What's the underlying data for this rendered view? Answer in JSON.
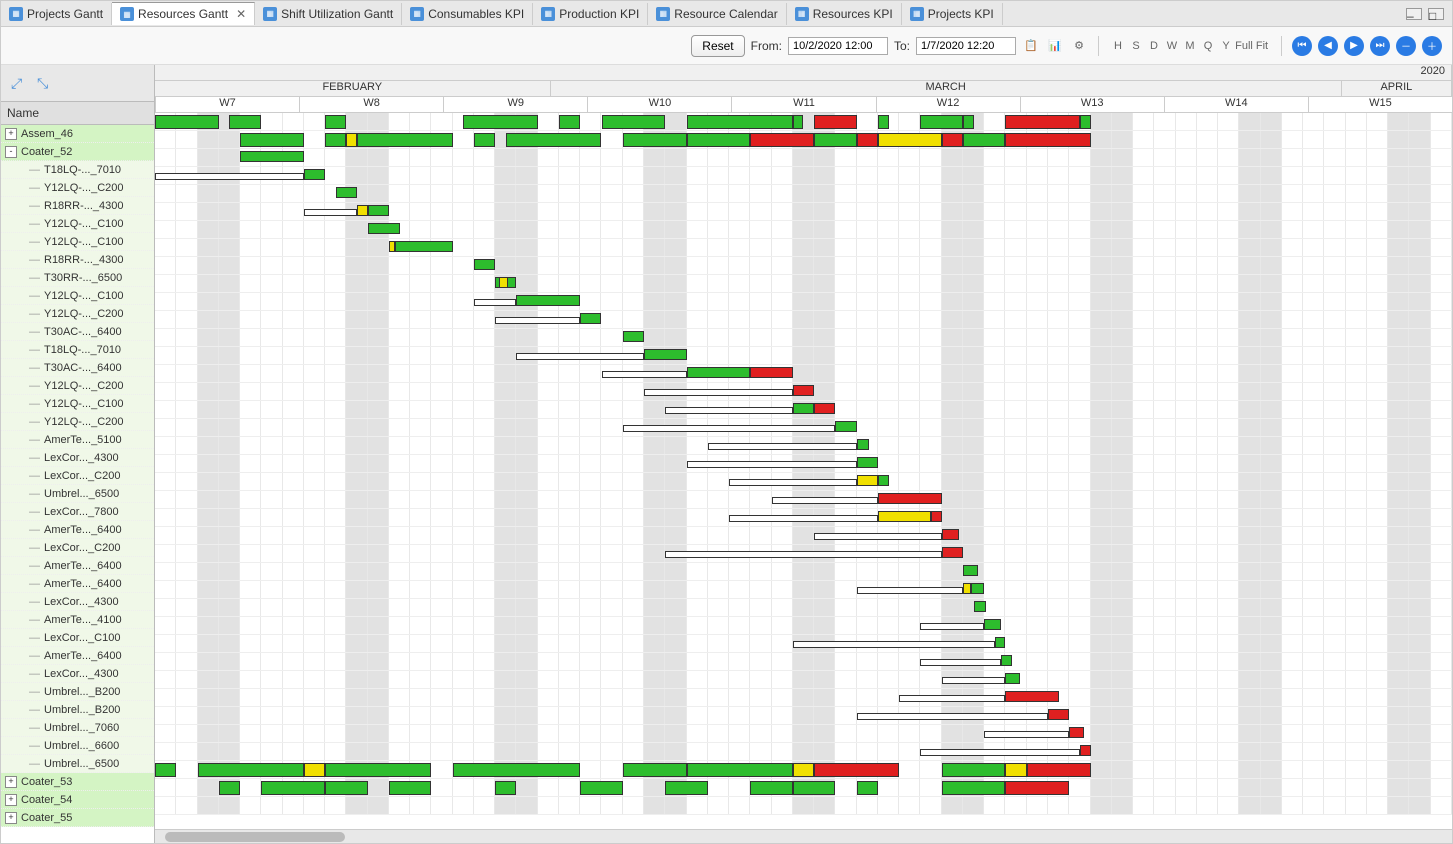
{
  "tabs": [
    {
      "label": "Projects Gantt",
      "active": false
    },
    {
      "label": "Resources Gantt",
      "active": true,
      "closable": true
    },
    {
      "label": "Shift Utilization Gantt",
      "active": false
    },
    {
      "label": "Consumables KPI",
      "active": false
    },
    {
      "label": "Production KPI",
      "active": false
    },
    {
      "label": "Resource Calendar",
      "active": false
    },
    {
      "label": "Resources KPI",
      "active": false
    },
    {
      "label": "Projects KPI",
      "active": false
    }
  ],
  "toolbar": {
    "reset": "Reset",
    "from_label": "From:",
    "from_value": "10/2/2020 12:00",
    "to_label": "To:",
    "to_value": "1/7/2020 12:20",
    "scale_buttons": [
      "H",
      "S",
      "D",
      "W",
      "M",
      "Q",
      "Y",
      "Full",
      "Fit"
    ]
  },
  "tree_header": "Name",
  "tree": [
    {
      "label": "Assem_46",
      "type": "summary",
      "exp": "+"
    },
    {
      "label": "Coater_52",
      "type": "summary",
      "exp": "-"
    },
    {
      "label": "T18LQ-..._7010",
      "type": "child"
    },
    {
      "label": "Y12LQ-..._C200",
      "type": "child"
    },
    {
      "label": "R18RR-..._4300",
      "type": "child"
    },
    {
      "label": "Y12LQ-..._C100",
      "type": "child"
    },
    {
      "label": "Y12LQ-..._C100",
      "type": "child"
    },
    {
      "label": "R18RR-..._4300",
      "type": "child"
    },
    {
      "label": "T30RR-..._6500",
      "type": "child"
    },
    {
      "label": "Y12LQ-..._C100",
      "type": "child"
    },
    {
      "label": "Y12LQ-..._C200",
      "type": "child"
    },
    {
      "label": "T30AC-..._6400",
      "type": "child"
    },
    {
      "label": "T18LQ-..._7010",
      "type": "child"
    },
    {
      "label": "T30AC-..._6400",
      "type": "child"
    },
    {
      "label": "Y12LQ-..._C200",
      "type": "child"
    },
    {
      "label": "Y12LQ-..._C100",
      "type": "child"
    },
    {
      "label": "Y12LQ-..._C200",
      "type": "child"
    },
    {
      "label": "AmerTe..._5100",
      "type": "child"
    },
    {
      "label": "LexCor..._4300",
      "type": "child"
    },
    {
      "label": "LexCor..._C200",
      "type": "child"
    },
    {
      "label": "Umbrel..._6500",
      "type": "child"
    },
    {
      "label": "LexCor..._7800",
      "type": "child"
    },
    {
      "label": "AmerTe..._6400",
      "type": "child"
    },
    {
      "label": "LexCor..._C200",
      "type": "child"
    },
    {
      "label": "AmerTe..._6400",
      "type": "child"
    },
    {
      "label": "AmerTe..._6400",
      "type": "child"
    },
    {
      "label": "LexCor..._4300",
      "type": "child"
    },
    {
      "label": "AmerTe..._4100",
      "type": "child"
    },
    {
      "label": "LexCor..._C100",
      "type": "child"
    },
    {
      "label": "AmerTe..._6400",
      "type": "child"
    },
    {
      "label": "LexCor..._4300",
      "type": "child"
    },
    {
      "label": "Umbrel..._B200",
      "type": "child"
    },
    {
      "label": "Umbrel..._B200",
      "type": "child"
    },
    {
      "label": "Umbrel..._7060",
      "type": "child"
    },
    {
      "label": "Umbrel..._6600",
      "type": "child"
    },
    {
      "label": "Umbrel..._6500",
      "type": "child"
    },
    {
      "label": "Coater_53",
      "type": "summary",
      "exp": "+"
    },
    {
      "label": "Coater_54",
      "type": "summary",
      "exp": "+"
    },
    {
      "label": "Coater_55",
      "type": "summary",
      "exp": "+"
    }
  ],
  "timeline": {
    "year": "2020",
    "months": [
      {
        "label": "FEBRUARY",
        "width_pct": 30.5
      },
      {
        "label": "MARCH",
        "width_pct": 61
      },
      {
        "label": "APRIL",
        "width_pct": 8.5
      }
    ],
    "weeks": [
      "W7",
      "W8",
      "W9",
      "W10",
      "W11",
      "W12",
      "W13",
      "W14",
      "W15"
    ],
    "total_days": 61,
    "weekend_cols": [
      2,
      3,
      9,
      10,
      16,
      17,
      23,
      24,
      30,
      31,
      37,
      38,
      44,
      45,
      51,
      52,
      58,
      59
    ]
  },
  "chart_data": {
    "type": "gantt",
    "x_unit": "day_index_from_start",
    "rows": [
      {
        "name": "Assem_46",
        "bars": [
          {
            "s": 0,
            "e": 3,
            "c": "g"
          },
          {
            "s": 3.5,
            "e": 5,
            "c": "g"
          },
          {
            "s": 8,
            "e": 9,
            "c": "g"
          },
          {
            "s": 14.5,
            "e": 18,
            "c": "g"
          },
          {
            "s": 19,
            "e": 20,
            "c": "g"
          },
          {
            "s": 21,
            "e": 24,
            "c": "g"
          },
          {
            "s": 25,
            "e": 30,
            "c": "g"
          },
          {
            "s": 30,
            "e": 30.5,
            "c": "g"
          },
          {
            "s": 31,
            "e": 33,
            "c": "r"
          },
          {
            "s": 34,
            "e": 34.5,
            "c": "g"
          },
          {
            "s": 36,
            "e": 38,
            "c": "g"
          },
          {
            "s": 38,
            "e": 38.5,
            "c": "g"
          },
          {
            "s": 40,
            "e": 43.5,
            "c": "r"
          },
          {
            "s": 43.5,
            "e": 44,
            "c": "g"
          }
        ]
      },
      {
        "name": "Coater_52",
        "bars": [
          {
            "s": 4,
            "e": 7,
            "c": "g"
          },
          {
            "s": 8,
            "e": 9,
            "c": "g"
          },
          {
            "s": 9,
            "e": 9.5,
            "c": "y"
          },
          {
            "s": 9.5,
            "e": 14,
            "c": "g"
          },
          {
            "s": 15,
            "e": 16,
            "c": "g"
          },
          {
            "s": 16.5,
            "e": 21,
            "c": "g"
          },
          {
            "s": 22,
            "e": 25,
            "c": "g"
          },
          {
            "s": 25,
            "e": 28,
            "c": "g"
          },
          {
            "s": 28,
            "e": 31,
            "c": "r"
          },
          {
            "s": 31,
            "e": 33,
            "c": "g"
          },
          {
            "s": 33,
            "e": 34,
            "c": "r"
          },
          {
            "s": 34,
            "e": 37,
            "c": "y"
          },
          {
            "s": 37,
            "e": 38,
            "c": "r"
          },
          {
            "s": 38,
            "e": 40,
            "c": "g"
          },
          {
            "s": 40,
            "e": 44,
            "c": "r"
          }
        ]
      },
      {
        "name": "T18LQ-..._7010",
        "bars": [
          {
            "s": 4,
            "e": 7,
            "c": "g"
          }
        ]
      },
      {
        "name": "Y12LQ-..._C200",
        "bars": [
          {
            "s": 0,
            "e": 7,
            "c": "w"
          },
          {
            "s": 7,
            "e": 8,
            "c": "g"
          }
        ]
      },
      {
        "name": "R18RR-..._4300",
        "bars": [
          {
            "s": 8.5,
            "e": 9.5,
            "c": "g"
          }
        ]
      },
      {
        "name": "Y12LQ-..._C100",
        "bars": [
          {
            "s": 7,
            "e": 9.5,
            "c": "w"
          },
          {
            "s": 9.5,
            "e": 10,
            "c": "y"
          },
          {
            "s": 10,
            "e": 11,
            "c": "g"
          }
        ]
      },
      {
        "name": "Y12LQ-..._C100",
        "bars": [
          {
            "s": 10,
            "e": 11.5,
            "c": "g"
          }
        ]
      },
      {
        "name": "R18RR-..._4300",
        "bars": [
          {
            "s": 11,
            "e": 11.3,
            "c": "y"
          },
          {
            "s": 11.3,
            "e": 14,
            "c": "g"
          }
        ]
      },
      {
        "name": "T30RR-..._6500",
        "bars": [
          {
            "s": 15,
            "e": 16,
            "c": "g"
          }
        ]
      },
      {
        "name": "Y12LQ-..._C100",
        "bars": [
          {
            "s": 16,
            "e": 17,
            "c": "g"
          },
          {
            "s": 16.2,
            "e": 16.6,
            "c": "y"
          }
        ]
      },
      {
        "name": "Y12LQ-..._C200",
        "bars": [
          {
            "s": 15,
            "e": 17,
            "c": "w"
          },
          {
            "s": 17,
            "e": 20,
            "c": "g"
          }
        ]
      },
      {
        "name": "T30AC-..._6400",
        "bars": [
          {
            "s": 16,
            "e": 20,
            "c": "w"
          },
          {
            "s": 20,
            "e": 21,
            "c": "g"
          }
        ]
      },
      {
        "name": "T18LQ-..._7010",
        "bars": [
          {
            "s": 22,
            "e": 23,
            "c": "g"
          }
        ]
      },
      {
        "name": "T30AC-..._6400",
        "bars": [
          {
            "s": 17,
            "e": 23,
            "c": "w"
          },
          {
            "s": 23,
            "e": 25,
            "c": "g"
          }
        ]
      },
      {
        "name": "Y12LQ-..._C200",
        "bars": [
          {
            "s": 21,
            "e": 25,
            "c": "w"
          },
          {
            "s": 25,
            "e": 28,
            "c": "g"
          },
          {
            "s": 28,
            "e": 30,
            "c": "r"
          }
        ]
      },
      {
        "name": "Y12LQ-..._C100",
        "bars": [
          {
            "s": 23,
            "e": 30,
            "c": "w"
          },
          {
            "s": 30,
            "e": 31,
            "c": "r"
          }
        ]
      },
      {
        "name": "Y12LQ-..._C200",
        "bars": [
          {
            "s": 24,
            "e": 30,
            "c": "w"
          },
          {
            "s": 30,
            "e": 31,
            "c": "g"
          },
          {
            "s": 31,
            "e": 32,
            "c": "r"
          }
        ]
      },
      {
        "name": "AmerTe..._5100",
        "bars": [
          {
            "s": 22,
            "e": 32,
            "c": "w"
          },
          {
            "s": 32,
            "e": 33,
            "c": "g"
          }
        ]
      },
      {
        "name": "LexCor..._4300",
        "bars": [
          {
            "s": 26,
            "e": 33,
            "c": "w"
          },
          {
            "s": 33,
            "e": 33.6,
            "c": "g"
          }
        ]
      },
      {
        "name": "LexCor..._C200",
        "bars": [
          {
            "s": 25,
            "e": 33,
            "c": "w"
          },
          {
            "s": 33,
            "e": 34,
            "c": "g"
          }
        ]
      },
      {
        "name": "Umbrel..._6500",
        "bars": [
          {
            "s": 27,
            "e": 33,
            "c": "w"
          },
          {
            "s": 33,
            "e": 34,
            "c": "y"
          },
          {
            "s": 34,
            "e": 34.5,
            "c": "g"
          }
        ]
      },
      {
        "name": "LexCor..._7800",
        "bars": [
          {
            "s": 29,
            "e": 34,
            "c": "w"
          },
          {
            "s": 34,
            "e": 37,
            "c": "r"
          }
        ]
      },
      {
        "name": "AmerTe..._6400",
        "bars": [
          {
            "s": 27,
            "e": 34,
            "c": "w"
          },
          {
            "s": 34,
            "e": 36.5,
            "c": "y"
          },
          {
            "s": 36.5,
            "e": 37,
            "c": "r"
          }
        ]
      },
      {
        "name": "LexCor..._C200",
        "bars": [
          {
            "s": 31,
            "e": 37,
            "c": "w"
          },
          {
            "s": 37,
            "e": 37.8,
            "c": "r"
          }
        ]
      },
      {
        "name": "AmerTe..._6400",
        "bars": [
          {
            "s": 24,
            "e": 37,
            "c": "w"
          },
          {
            "s": 37,
            "e": 38,
            "c": "r"
          }
        ]
      },
      {
        "name": "AmerTe..._6400",
        "bars": [
          {
            "s": 38,
            "e": 38.7,
            "c": "g"
          }
        ]
      },
      {
        "name": "LexCor..._4300",
        "bars": [
          {
            "s": 33,
            "e": 38,
            "c": "w"
          },
          {
            "s": 38,
            "e": 38.4,
            "c": "y"
          },
          {
            "s": 38.4,
            "e": 39,
            "c": "g"
          }
        ]
      },
      {
        "name": "AmerTe..._4100",
        "bars": [
          {
            "s": 38.5,
            "e": 39.1,
            "c": "g"
          }
        ]
      },
      {
        "name": "LexCor..._C100",
        "bars": [
          {
            "s": 36,
            "e": 39,
            "c": "w"
          },
          {
            "s": 39,
            "e": 39.8,
            "c": "g"
          }
        ]
      },
      {
        "name": "AmerTe..._6400",
        "bars": [
          {
            "s": 30,
            "e": 39.5,
            "c": "w"
          },
          {
            "s": 39.5,
            "e": 40,
            "c": "g"
          }
        ]
      },
      {
        "name": "LexCor..._4300",
        "bars": [
          {
            "s": 36,
            "e": 39.8,
            "c": "w"
          },
          {
            "s": 39.8,
            "e": 40.3,
            "c": "g"
          }
        ]
      },
      {
        "name": "Umbrel..._B200",
        "bars": [
          {
            "s": 37,
            "e": 40,
            "c": "w"
          },
          {
            "s": 40,
            "e": 40.7,
            "c": "g"
          }
        ]
      },
      {
        "name": "Umbrel..._B200",
        "bars": [
          {
            "s": 35,
            "e": 40,
            "c": "w"
          },
          {
            "s": 40,
            "e": 42.5,
            "c": "r"
          }
        ]
      },
      {
        "name": "Umbrel..._7060",
        "bars": [
          {
            "s": 33,
            "e": 42,
            "c": "w"
          },
          {
            "s": 42,
            "e": 43,
            "c": "r"
          }
        ]
      },
      {
        "name": "Umbrel..._6600",
        "bars": [
          {
            "s": 39,
            "e": 43,
            "c": "w"
          },
          {
            "s": 43,
            "e": 43.7,
            "c": "r"
          }
        ]
      },
      {
        "name": "Umbrel..._6500",
        "bars": [
          {
            "s": 36,
            "e": 43.5,
            "c": "w"
          },
          {
            "s": 43.5,
            "e": 44,
            "c": "r"
          }
        ]
      },
      {
        "name": "Coater_53",
        "bars": [
          {
            "s": 0,
            "e": 1,
            "c": "g"
          },
          {
            "s": 2,
            "e": 7,
            "c": "g"
          },
          {
            "s": 7,
            "e": 8,
            "c": "y"
          },
          {
            "s": 8,
            "e": 13,
            "c": "g"
          },
          {
            "s": 14,
            "e": 20,
            "c": "g"
          },
          {
            "s": 22,
            "e": 25,
            "c": "g"
          },
          {
            "s": 25,
            "e": 30,
            "c": "g"
          },
          {
            "s": 30,
            "e": 31,
            "c": "y"
          },
          {
            "s": 31,
            "e": 35,
            "c": "r"
          },
          {
            "s": 37,
            "e": 40,
            "c": "g"
          },
          {
            "s": 40,
            "e": 41,
            "c": "y"
          },
          {
            "s": 41,
            "e": 44,
            "c": "r"
          }
        ]
      },
      {
        "name": "Coater_54",
        "bars": [
          {
            "s": 3,
            "e": 4,
            "c": "g"
          },
          {
            "s": 5,
            "e": 8,
            "c": "g"
          },
          {
            "s": 8,
            "e": 10,
            "c": "g"
          },
          {
            "s": 11,
            "e": 13,
            "c": "g"
          },
          {
            "s": 16,
            "e": 17,
            "c": "g"
          },
          {
            "s": 20,
            "e": 22,
            "c": "g"
          },
          {
            "s": 24,
            "e": 26,
            "c": "g"
          },
          {
            "s": 28,
            "e": 30,
            "c": "g"
          },
          {
            "s": 30,
            "e": 32,
            "c": "g"
          },
          {
            "s": 33,
            "e": 34,
            "c": "g"
          },
          {
            "s": 37,
            "e": 40,
            "c": "g"
          },
          {
            "s": 40,
            "e": 43,
            "c": "r"
          }
        ]
      },
      {
        "name": "Coater_55",
        "bars": []
      }
    ]
  }
}
